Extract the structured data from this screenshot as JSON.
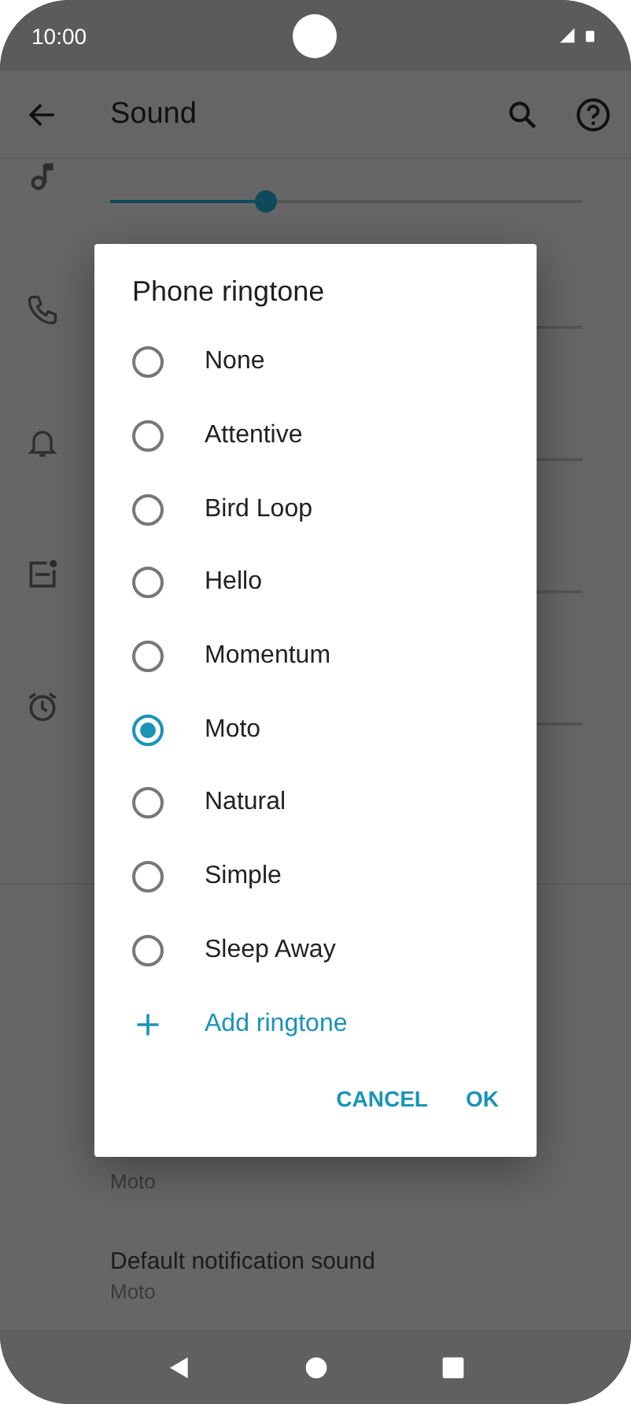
{
  "status_bar": {
    "time": "10:00"
  },
  "app_bar": {
    "title": "Sound"
  },
  "volume_rows": [
    {
      "kind": "media",
      "level": 0.33
    },
    {
      "kind": "call"
    },
    {
      "kind": "ring"
    },
    {
      "kind": "notification"
    },
    {
      "kind": "alarm"
    }
  ],
  "background_items": [
    {
      "summary": "Moto"
    },
    {
      "title": "Default notification sound",
      "summary": "Moto"
    }
  ],
  "dialog": {
    "title": "Phone ringtone",
    "options": [
      {
        "label": "None",
        "selected": false
      },
      {
        "label": "Attentive",
        "selected": false
      },
      {
        "label": "Bird Loop",
        "selected": false
      },
      {
        "label": "Hello",
        "selected": false
      },
      {
        "label": "Momentum",
        "selected": false
      },
      {
        "label": "Moto",
        "selected": true
      },
      {
        "label": "Natural",
        "selected": false
      },
      {
        "label": "Simple",
        "selected": false
      },
      {
        "label": "Sleep Away",
        "selected": false
      }
    ],
    "add_action": "Add ringtone",
    "buttons": [
      "CANCEL",
      "OK"
    ]
  }
}
